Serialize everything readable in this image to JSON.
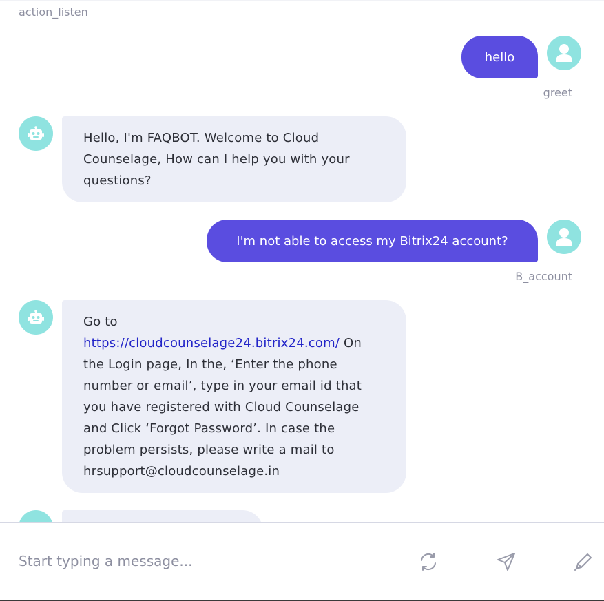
{
  "messages": {
    "action_label": "action_listen",
    "user_1": {
      "text": "hello",
      "intent": "greet"
    },
    "bot_1": {
      "text": "Hello, I'm FAQBOT. Welcome to Cloud Counselage, How can I help you with your questions?"
    },
    "user_2": {
      "text": "I'm not able to access my Bitrix24 account?",
      "intent": "B_account"
    },
    "bot_2": {
      "prefix": "Go to",
      "link": "https://cloudcounselage24.bitrix24.com/",
      "suffix": "On the Login page, In the, ‘Enter the phone number or email’, type in your email id that you have registered with Cloud Counselage and Click ‘Forgot Password’. In case the problem persists, please write a mail to hrsupport@cloudcounselage.in"
    }
  },
  "composer": {
    "placeholder": "Start typing a message...",
    "value": "",
    "icons": [
      "refresh-icon",
      "send-icon",
      "pen-icon"
    ]
  },
  "colors": {
    "user_bubble": "#5a4de0",
    "bot_bubble": "#eceef7",
    "avatar": "#8fe3e0",
    "muted_text": "#8d8fa0",
    "link": "#2224c8"
  }
}
